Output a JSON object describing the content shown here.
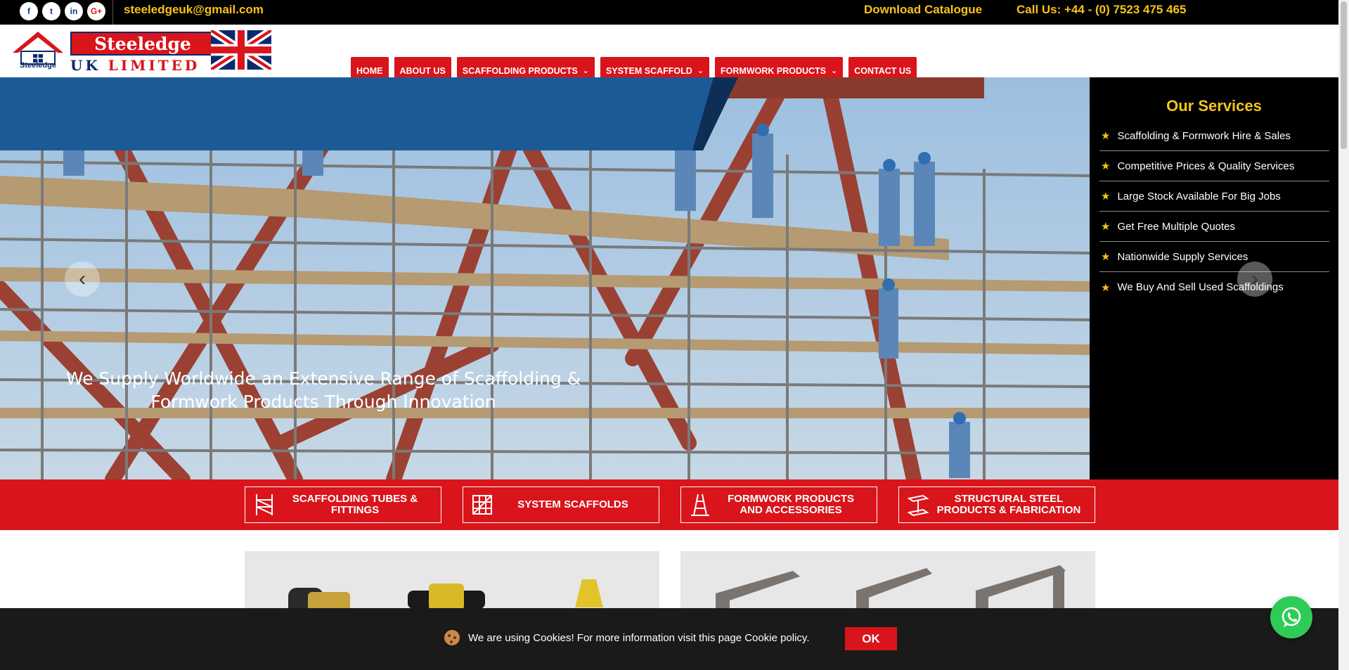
{
  "topbar": {
    "social": [
      {
        "icon": "facebook-icon",
        "glyph": "f"
      },
      {
        "icon": "twitter-icon",
        "glyph": "t"
      },
      {
        "icon": "linkedin-icon",
        "glyph": "in"
      },
      {
        "icon": "google-plus-icon",
        "glyph": "G+"
      }
    ],
    "email": "steeledgeuk@gmail.com",
    "catalogue": "Download Catalogue",
    "phone": "Call Us: +44 - (0) 7523 475 465"
  },
  "logo": {
    "brand": "Steeledge",
    "sub_uk": "UK",
    "sub_limited": "LIMITED",
    "house_text": "Steeledge"
  },
  "nav": {
    "items": [
      {
        "label": "HOME",
        "dropdown": false
      },
      {
        "label": "ABOUT US",
        "dropdown": false
      },
      {
        "label": "SCAFFOLDING PRODUCTS",
        "dropdown": true
      },
      {
        "label": "SYSTEM SCAFFOLD",
        "dropdown": true
      },
      {
        "label": "FORMWORK PRODUCTS",
        "dropdown": true
      },
      {
        "label": "CONTACT US",
        "dropdown": false
      }
    ]
  },
  "hero": {
    "line1": "We Supply Worldwide an Extensive Range of Scaffolding &",
    "line2": "Formwork Products Through Innovation",
    "prev": "‹",
    "next": "›"
  },
  "services": {
    "title": "Our Services",
    "items": [
      "Scaffolding & Formwork Hire & Sales",
      "Competitive Prices & Quality Services",
      "Large Stock Available For Big Jobs",
      "Get Free Multiple Quotes",
      "Nationwide Supply Services",
      "We Buy And Sell Used Scaffoldings"
    ]
  },
  "categories": [
    {
      "line1": "SCAFFOLDING TUBES &",
      "line2": "FITTINGS",
      "icon": "scaffold-tubes-icon"
    },
    {
      "line1": "SYSTEM SCAFFOLDS",
      "line2": "",
      "icon": "system-scaffold-icon"
    },
    {
      "line1": "FORMWORK PRODUCTS",
      "line2": "AND ACCESSORIES",
      "icon": "formwork-icon"
    },
    {
      "line1": "STRUCTURAL STEEL",
      "line2": "PRODUCTS & FABRICATION",
      "icon": "steel-beam-icon"
    }
  ],
  "cookie": {
    "message": "We are using Cookies! For more information visit this page Cookie policy.",
    "ok": "OK"
  },
  "colors": {
    "accent_red": "#d9141b",
    "gold": "#f5c31a",
    "banner_blue": "#1c5a96"
  }
}
